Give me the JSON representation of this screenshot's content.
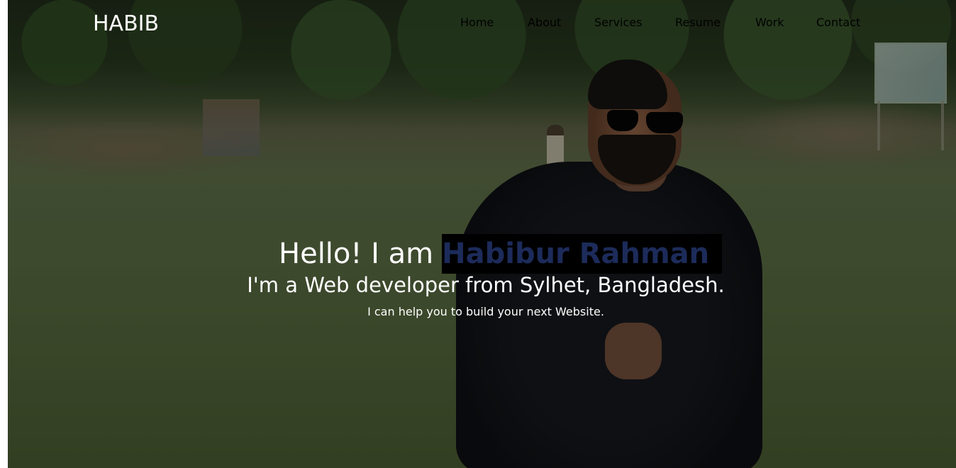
{
  "header": {
    "logo": "HABIB",
    "nav": [
      {
        "label": "Home"
      },
      {
        "label": "About"
      },
      {
        "label": "Services"
      },
      {
        "label": "Resume"
      },
      {
        "label": "Work"
      },
      {
        "label": "Contact"
      }
    ]
  },
  "hero": {
    "greeting": "Hello! I am",
    "name": "Habibur Rahman",
    "tagline": "I'm a Web developer from Sylhet, Bangladesh.",
    "subtext": "I can help you to build your next Website.",
    "name_color": "#1c2b5a",
    "name_background": "#000000"
  }
}
